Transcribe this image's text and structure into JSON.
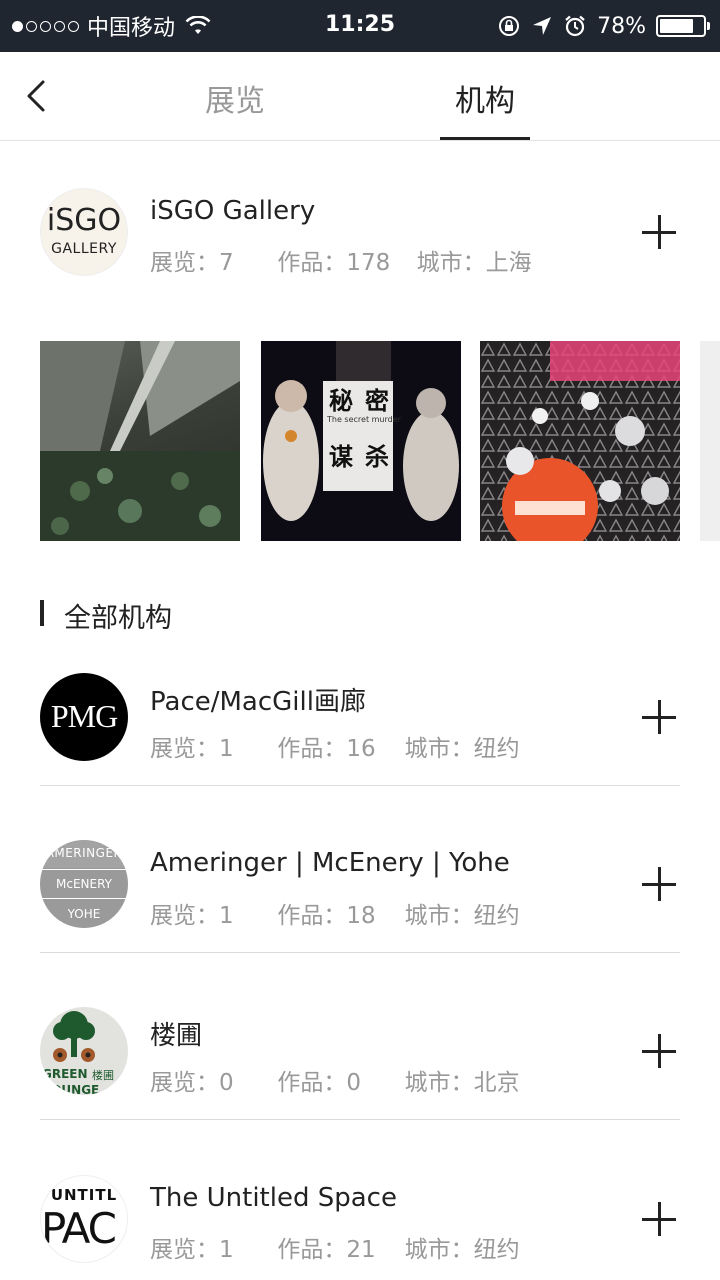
{
  "status_bar": {
    "carrier": "中国移动",
    "time": "11:25",
    "battery": "78%",
    "battery_level": 0.78
  },
  "nav": {
    "tabs": [
      {
        "label": "展览",
        "active": false
      },
      {
        "label": "机构",
        "active": true
      }
    ]
  },
  "featured": {
    "name": "iSGO Gallery",
    "logo_text": [
      "iSGO",
      "GALLERY"
    ],
    "exhibitions": "展览：7",
    "works": "作品：178",
    "city": "城市：上海"
  },
  "thumbnails": [
    {
      "name": "forest-artwork"
    },
    {
      "name": "secret-murder-poster",
      "text": [
        "秘",
        "密",
        "谋",
        "杀",
        "The secret murder"
      ]
    },
    {
      "name": "neon-art-festival"
    }
  ],
  "section": {
    "title": "全部机构"
  },
  "institutions": [
    {
      "name": "Pace/MacGill画廊",
      "logo": "PMG",
      "exhibitions": "展览：1",
      "works": "作品：16",
      "city": "城市：纽约"
    },
    {
      "name": "Ameringer | McEnery | Yohe",
      "logo_lines": [
        "AMERINGER",
        "McENERY",
        "YOHE"
      ],
      "exhibitions": "展览：1",
      "works": "作品：18",
      "city": "城市：纽约"
    },
    {
      "name": "楼圃",
      "logo_lines": [
        "GREEN",
        "楼圃",
        "LOUNGE"
      ],
      "exhibitions": "展览：0",
      "works": "作品：0",
      "city": "城市：北京"
    },
    {
      "name": "The Untitled Space",
      "logo_lines": [
        "UNTITL",
        "PAC"
      ],
      "exhibitions": "展览：1",
      "works": "作品：21",
      "city": "城市：纽约"
    }
  ],
  "colors": {
    "status_bar_bg": "#202630",
    "text_primary": "#222222",
    "text_secondary": "#999999",
    "divider": "#dcdcdc"
  }
}
